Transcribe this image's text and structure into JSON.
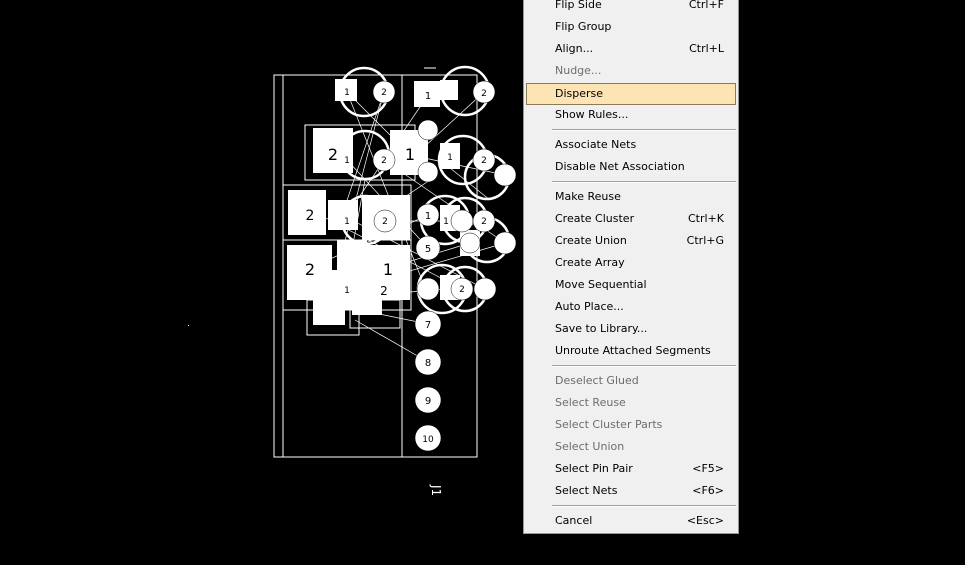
{
  "canvas": {
    "components": [
      {
        "pins": [
          "1",
          "2"
        ]
      },
      {
        "pins": [
          "1",
          "2"
        ]
      },
      {
        "pins": [
          "2",
          "1",
          "2"
        ]
      },
      {
        "pins": [
          "1",
          "1",
          "2"
        ]
      },
      {
        "pins": [
          "2",
          "1",
          "2"
        ]
      },
      {
        "pins": [
          "1",
          "1",
          "2"
        ]
      },
      {
        "pins": [
          "2",
          "1",
          "2"
        ]
      },
      {
        "pins": [
          "1",
          "2"
        ]
      }
    ],
    "connector_pins": [
      "5",
      "7",
      "8",
      "9",
      "10"
    ],
    "connector_designator": "J1"
  },
  "menu": {
    "items": [
      {
        "label": "Flip Side",
        "shortcut": "Ctrl+F",
        "disabled": false
      },
      {
        "label": "Flip Group",
        "shortcut": "",
        "disabled": false
      },
      {
        "label": "Align...",
        "shortcut": "Ctrl+L",
        "disabled": false
      },
      {
        "label": "Nudge...",
        "shortcut": "",
        "disabled": true
      },
      {
        "label": "Disperse",
        "shortcut": "",
        "disabled": false,
        "highlighted": true
      },
      {
        "label": "Show Rules...",
        "shortcut": "",
        "disabled": false
      },
      {
        "label": "Associate Nets",
        "shortcut": "",
        "disabled": false
      },
      {
        "label": "Disable Net Association",
        "shortcut": "",
        "disabled": false
      },
      {
        "label": "Make Reuse",
        "shortcut": "",
        "disabled": false
      },
      {
        "label": "Create Cluster",
        "shortcut": "Ctrl+K",
        "disabled": false
      },
      {
        "label": "Create Union",
        "shortcut": "Ctrl+G",
        "disabled": false
      },
      {
        "label": "Create Array",
        "shortcut": "",
        "disabled": false
      },
      {
        "label": "Move Sequential",
        "shortcut": "",
        "disabled": false
      },
      {
        "label": "Auto Place...",
        "shortcut": "",
        "disabled": false
      },
      {
        "label": "Save to Library...",
        "shortcut": "",
        "disabled": false
      },
      {
        "label": "Unroute Attached Segments",
        "shortcut": "",
        "disabled": false
      },
      {
        "label": "Deselect Glued",
        "shortcut": "",
        "disabled": true
      },
      {
        "label": "Select Reuse",
        "shortcut": "",
        "disabled": true
      },
      {
        "label": "Select Cluster Parts",
        "shortcut": "",
        "disabled": true
      },
      {
        "label": "Select Union",
        "shortcut": "",
        "disabled": true
      },
      {
        "label": "Select Pin Pair",
        "shortcut": "<F5>",
        "disabled": false
      },
      {
        "label": "Select Nets",
        "shortcut": "<F6>",
        "disabled": false
      },
      {
        "label": "Cancel",
        "shortcut": "<Esc>",
        "disabled": false
      }
    ]
  },
  "colors": {
    "canvas_bg": "#000000",
    "pcb_outline": "#ffffff",
    "menu_bg": "#f0f0f0",
    "menu_highlight": "#fde4b4",
    "disabled_text": "#6d6d6d"
  }
}
